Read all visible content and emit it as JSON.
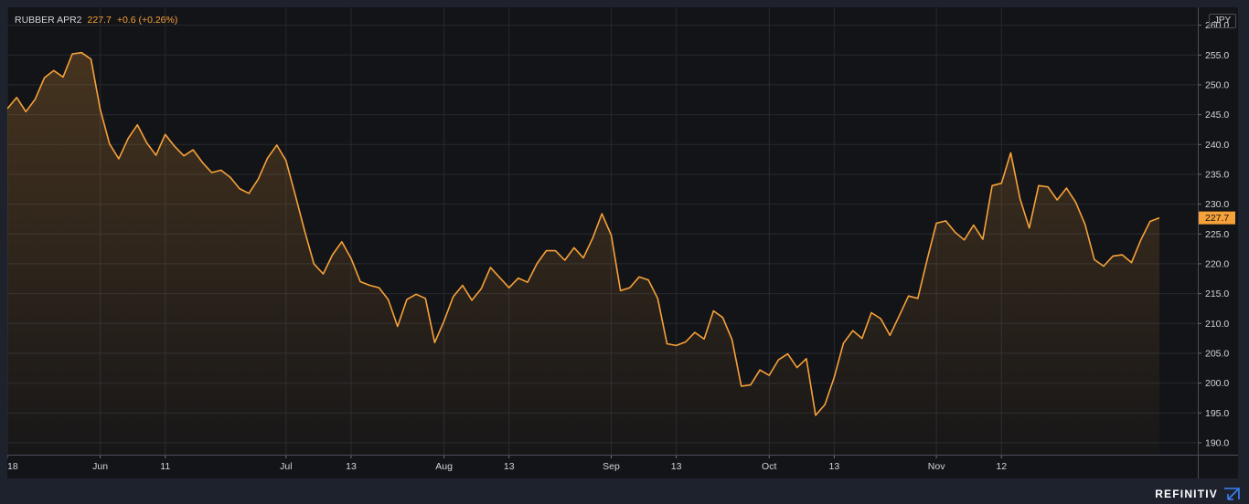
{
  "header": {
    "symbol": "RUBBER APR2",
    "last": "227.7",
    "change": "+0.6 (+0.26%)"
  },
  "currency": "JPY",
  "brand": {
    "name": "REFINITIV",
    "icon": "refinitiv-arrow-icon"
  },
  "colors": {
    "line": "#f7a13a",
    "background": "#131417",
    "frame": "#1e222d",
    "grid": "#262930",
    "text": "#d1d4dc"
  },
  "chart_data": {
    "type": "area",
    "title": "",
    "xlabel": "",
    "ylabel": "",
    "ylim": [
      188,
      263
    ],
    "yticks": [
      190,
      195,
      200,
      205,
      210,
      215,
      220,
      225,
      230,
      235,
      240,
      245,
      250,
      255,
      260
    ],
    "ytick_labels": [
      "190.0",
      "195.0",
      "200.0",
      "205.0",
      "210.0",
      "215.0",
      "220.0",
      "225.0",
      "230.0",
      "235.0",
      "240.0",
      "245.0",
      "250.0",
      "255.0",
      "260.0"
    ],
    "x_tick_labels": [
      {
        "label": "18",
        "index": 0
      },
      {
        "label": "Jun",
        "index": 10
      },
      {
        "label": "11",
        "index": 17
      },
      {
        "label": "Jul",
        "index": 30
      },
      {
        "label": "13",
        "index": 37
      },
      {
        "label": "Aug",
        "index": 47
      },
      {
        "label": "13",
        "index": 54
      },
      {
        "label": "Sep",
        "index": 65
      },
      {
        "label": "13",
        "index": 72
      },
      {
        "label": "Oct",
        "index": 82
      },
      {
        "label": "13",
        "index": 89
      },
      {
        "label": "Nov",
        "index": 100
      },
      {
        "label": "12",
        "index": 107
      }
    ],
    "last_value_label": "227.7",
    "series": [
      {
        "name": "RUBBER APR2",
        "values": [
          246.0,
          247.9,
          245.5,
          247.6,
          251.2,
          252.4,
          251.3,
          255.2,
          255.4,
          254.3,
          245.9,
          240.1,
          237.6,
          241.0,
          243.3,
          240.3,
          238.2,
          241.7,
          239.7,
          238.1,
          239.1,
          237.0,
          235.3,
          235.7,
          234.5,
          232.6,
          231.8,
          234.2,
          237.7,
          239.9,
          237.3,
          231.5,
          225.5,
          220.0,
          218.3,
          221.5,
          223.7,
          220.9,
          217.0,
          216.4,
          216.0,
          214.0,
          209.5,
          214.0,
          214.9,
          214.2,
          206.8,
          210.4,
          214.5,
          216.4,
          213.9,
          215.8,
          219.4,
          217.7,
          216.0,
          217.6,
          216.9,
          220.0,
          222.2,
          222.2,
          220.6,
          222.7,
          221.0,
          224.3,
          228.4,
          224.8,
          215.5,
          216.0,
          217.8,
          217.3,
          214.2,
          206.6,
          206.3,
          206.9,
          208.5,
          207.4,
          212.1,
          211.0,
          207.3,
          199.5,
          199.7,
          202.2,
          201.3,
          203.9,
          204.9,
          202.6,
          204.1,
          194.6,
          196.4,
          201.0,
          206.7,
          208.8,
          207.5,
          211.8,
          210.8,
          208.0,
          211.3,
          214.6,
          214.2,
          220.7,
          226.8,
          227.2,
          225.3,
          224.0,
          226.5,
          224.1,
          233.1,
          233.5,
          238.6,
          230.9,
          226.0,
          233.1,
          232.9,
          230.7,
          232.7,
          230.3,
          226.6,
          220.7,
          219.6,
          221.3,
          221.5,
          220.2,
          224.0,
          227.1,
          227.7
        ]
      }
    ]
  }
}
